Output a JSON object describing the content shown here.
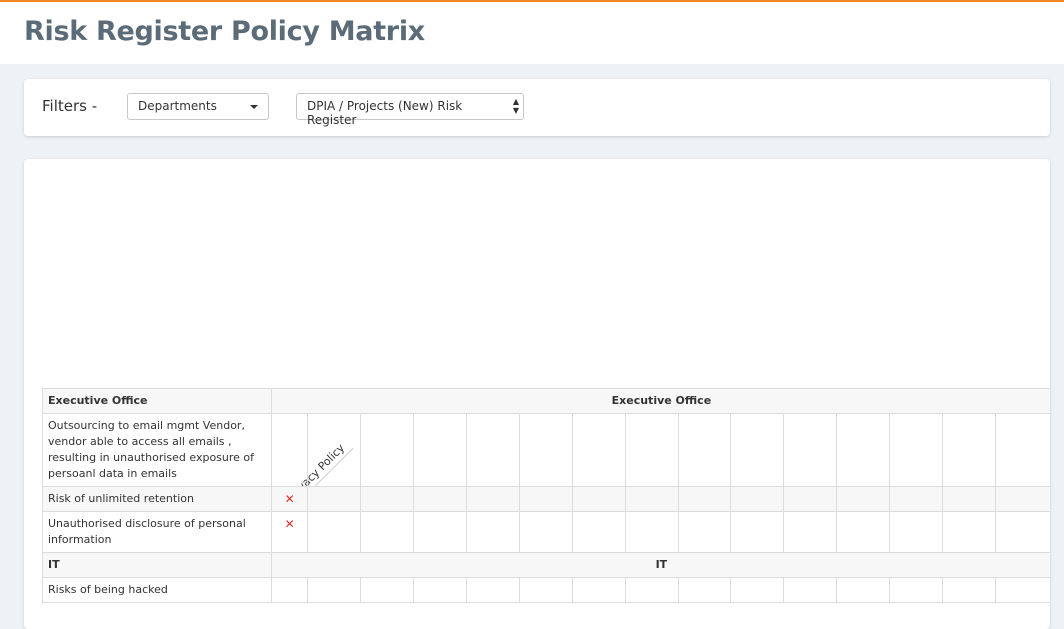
{
  "page": {
    "title": "Risk Register Policy Matrix"
  },
  "filters": {
    "label": "Filters  -",
    "department_select": {
      "value": "Departments"
    },
    "register_select": {
      "value": "DPIA / Projects (New) Risk Register"
    }
  },
  "matrix": {
    "policy_columns": [
      "Privacy Policy"
    ],
    "colors": {
      "mark": "#e0312f"
    },
    "groups": [
      {
        "name": "Executive Office",
        "risks": [
          {
            "label": "Outsourcing to email mgmt Vendor, vendor able to access all emails , resulting in unauthorised exposure of persoanl data in emails",
            "mark": ""
          },
          {
            "label": "Risk of unlimited retention",
            "mark": "✕"
          },
          {
            "label": "Unauthorised disclosure of personal information",
            "mark": "✕"
          }
        ]
      },
      {
        "name": "IT",
        "risks": [
          {
            "label": "Risks of being hacked",
            "mark": ""
          }
        ]
      }
    ]
  }
}
